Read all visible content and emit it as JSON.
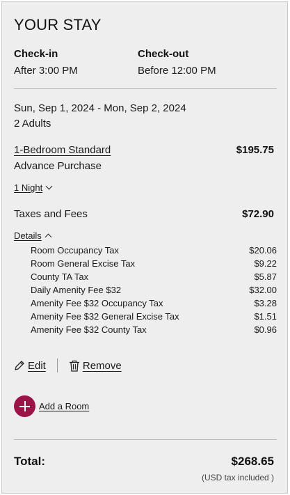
{
  "stay": {
    "title": "YOUR STAY",
    "checkin_label": "Check-in",
    "checkin_value": "After 3:00 PM",
    "checkout_label": "Check-out",
    "checkout_value": "Before 12:00 PM",
    "dates": "Sun, Sep 1, 2024 - Mon, Sep 2, 2024",
    "guests": "2 Adults"
  },
  "room": {
    "name": "1-Bedroom Standard",
    "rate_plan": "Advance Purchase",
    "price": "$195.75",
    "nights": "1 Night"
  },
  "taxes": {
    "label": "Taxes and Fees",
    "amount": "$72.90",
    "details_label": "Details",
    "items": [
      {
        "name": "Room Occupancy Tax",
        "amount": "$20.06"
      },
      {
        "name": "Room General Excise Tax",
        "amount": "$9.22"
      },
      {
        "name": "County TA Tax",
        "amount": "$5.87"
      },
      {
        "name": "Daily Amenity Fee $32",
        "amount": "$32.00"
      },
      {
        "name": "Amenity Fee $32 Occupancy Tax",
        "amount": "$3.28"
      },
      {
        "name": "Amenity Fee $32 General Excise Tax",
        "amount": "$1.51"
      },
      {
        "name": "Amenity Fee $32 County Tax",
        "amount": "$0.96"
      }
    ]
  },
  "actions": {
    "edit_label": "Edit",
    "remove_label": "Remove",
    "add_room_label": "Add a Room",
    "edit_icon": "pencil-icon",
    "remove_icon": "trash-icon",
    "add_icon": "plus-icon"
  },
  "total": {
    "label": "Total:",
    "amount": "$268.65",
    "note": "(USD tax included )"
  },
  "colors": {
    "accent": "#9b1447",
    "panel_bg": "#eeeeee",
    "divider": "#b5b5b5"
  }
}
